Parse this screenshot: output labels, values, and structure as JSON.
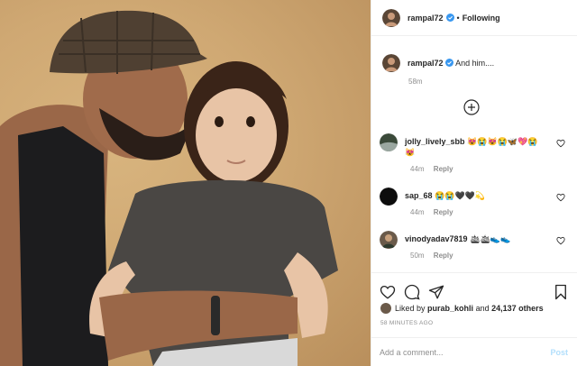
{
  "post": {
    "author": "rampal72",
    "dot": "•",
    "follow_status": "Following",
    "caption_user": "rampal72",
    "caption_text": "And him....",
    "caption_time": "58m",
    "comments": [
      {
        "user": "jolly_lively_sbb",
        "text": "😻😭😻😭🦋💖😭 😻",
        "time": "44m",
        "reply": "Reply"
      },
      {
        "user": "sap_68",
        "text": "😭😭🖤🖤💫",
        "time": "44m",
        "reply": "Reply"
      },
      {
        "user": "vinodyadav7819",
        "text": "🛳🛳👟👟",
        "time": "50m",
        "reply": "Reply"
      }
    ],
    "liked_prefix": "Liked by",
    "liked_user": "purab_kohli",
    "liked_and": "and",
    "liked_others": "24,137 others",
    "time_ago": "58 MINUTES AGO",
    "comment_placeholder": "Add a comment...",
    "post_label": "Post"
  },
  "colors": {
    "verified": "#3897f0",
    "muted": "#8e8e8e",
    "post_disabled": "#b2dffc"
  },
  "icons": [
    "verified-badge-icon",
    "add-circle-icon",
    "heart-icon",
    "comment-icon",
    "share-icon",
    "bookmark-icon",
    "small-heart-icon"
  ]
}
